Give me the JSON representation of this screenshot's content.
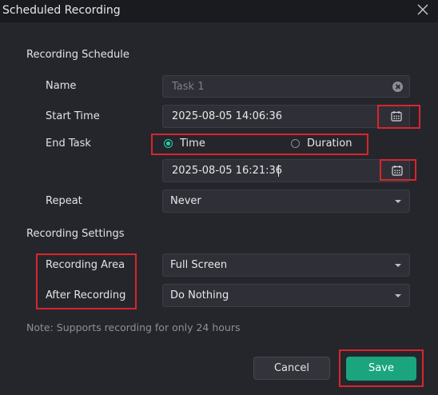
{
  "window": {
    "title": "Scheduled Recording"
  },
  "schedule": {
    "section_title": "Recording Schedule",
    "name_label": "Name",
    "name_placeholder": "Task 1",
    "start_label": "Start Time",
    "start_value": "2025-08-05 14:06:36",
    "end_label": "End Task",
    "end_options": [
      "Time",
      "Duration"
    ],
    "end_selected": "Time",
    "end_value": "2025-08-05 16:21:36",
    "repeat_label": "Repeat",
    "repeat_value": "Never"
  },
  "settings": {
    "section_title": "Recording Settings",
    "area_label": "Recording Area",
    "area_value": "Full Screen",
    "after_label": "After Recording",
    "after_value": "Do Nothing"
  },
  "note": "Note: Supports recording for only 24 hours",
  "buttons": {
    "cancel": "Cancel",
    "save": "Save"
  },
  "colors": {
    "accent": "#1aa57e",
    "radio_selected": "#21d6ab",
    "highlight": "#d8252c",
    "background": "#25262c"
  },
  "icons": [
    "close-icon",
    "clear-icon",
    "calendar-icon",
    "chevron-down-icon"
  ]
}
